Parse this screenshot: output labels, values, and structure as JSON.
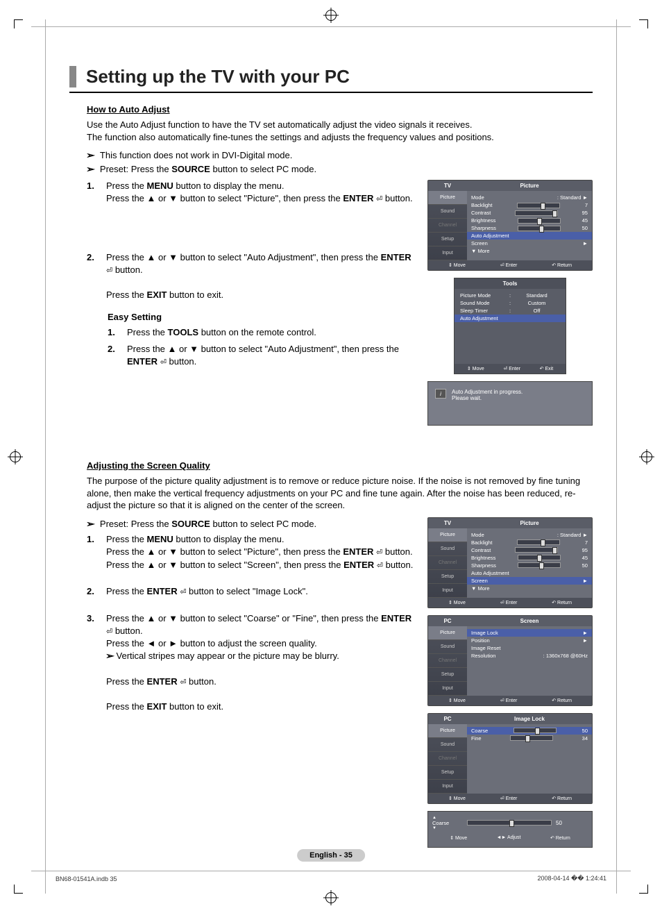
{
  "title": "Setting up the TV with your PC",
  "sec1_head": "How to Auto Adjust",
  "sec1_p1": "Use the Auto Adjust function to have the TV set automatically adjust the video signals it receives.",
  "sec1_p2": "The function also automatically fine-tunes the settings and adjusts the frequency values and positions.",
  "sec1_note1": "This function does not work in DVI-Digital mode.",
  "sec1_note2a": "Preset: Press the ",
  "sec1_note2b": "SOURCE",
  "sec1_note2c": " button to select PC mode.",
  "s1_1a": "Press the ",
  "s1_1b": "MENU",
  "s1_1c": " button to display the menu.",
  "s1_1d": "Press the ▲ or ▼ button to select \"Picture\", then press the ",
  "s1_1e": "ENTER",
  "s1_1f": " button.",
  "s1_2a": "Press the ▲ or ▼ button to select \"Auto Adjustment\", then press the ",
  "s1_2b": "ENTER",
  "s1_2c": " button.",
  "s1_2d": "Press the ",
  "s1_2e": "EXIT",
  "s1_2f": " button to exit.",
  "easy_head": "Easy Setting",
  "easy_1a": "Press the ",
  "easy_1b": "TOOLS",
  "easy_1c": " button on the remote control.",
  "easy_2a": "Press the ▲ or ▼ button to select \"Auto Adjustment\", then press the ",
  "easy_2b": "ENTER",
  "easy_2c": " button.",
  "sec2_head": "Adjusting the Screen Quality",
  "sec2_p": "The purpose of the picture quality adjustment is to remove or reduce picture noise. If the noise is not removed by fine tuning alone, then make the vertical frequency adjustments on your PC and fine tune again. After the noise has been reduced, re-adjust the picture so that it is aligned on the center of the screen.",
  "sec2_note_a": "Preset: Press the ",
  "sec2_note_b": "SOURCE",
  "sec2_note_c": " button to select PC mode.",
  "s2_1a": "Press the ",
  "s2_1b": "MENU",
  "s2_1c": " button to display the menu.",
  "s2_1d": "Press the ▲ or ▼ button to select \"Picture\", then press the ",
  "s2_1e": "ENTER",
  "s2_1f": " button.",
  "s2_1g": "Press the ▲ or ▼ button to select \"Screen\", then press the ",
  "s2_1h": "ENTER",
  "s2_1i": " button.",
  "s2_2a": "Press the ",
  "s2_2b": "ENTER",
  "s2_2c": " button to select \"Image Lock\".",
  "s2_3a": "Press the ▲ or ▼ button to select \"Coarse\" or \"Fine\", then press the ",
  "s2_3b": "ENTER",
  "s2_3c": " button.",
  "s2_3d": "Press the ◄ or ► button to adjust the screen quality.",
  "s2_3e": "Vertical stripes may appear or the picture may be blurry.",
  "s2_3f": "Press the ",
  "s2_3g": "ENTER",
  "s2_3h": " button.",
  "s2_3i": "Press the ",
  "s2_3j": "EXIT",
  "s2_3k": " button to exit.",
  "osd1": {
    "left": "TV",
    "right": "Picture",
    "side": [
      "Picture",
      "Sound",
      "Channel",
      "Setup",
      "Input"
    ],
    "rows": [
      {
        "l": "Mode",
        "v": ": Standard",
        "arrow": "►"
      },
      {
        "l": "Backlight",
        "v": "7",
        "slider": 55
      },
      {
        "l": "Contrast",
        "v": "95",
        "slider": 90
      },
      {
        "l": "Brightness",
        "v": "45",
        "slider": 45
      },
      {
        "l": "Sharpness",
        "v": "50",
        "slider": 50
      }
    ],
    "hl": "Auto Adjustment",
    "scr": {
      "l": "Screen",
      "v": "►"
    },
    "more": "▼ More",
    "foot": [
      "⇕ Move",
      "⏎ Enter",
      "↶ Return"
    ]
  },
  "tools": {
    "title": "Tools",
    "rows": [
      {
        "l": "Picture Mode",
        "v": "Standard"
      },
      {
        "l": "Sound Mode",
        "v": "Custom"
      },
      {
        "l": "Sleep Timer",
        "v": "Off"
      }
    ],
    "hl": "Auto Adjustment",
    "foot": [
      "⇕ Move",
      "⏎ Enter",
      "↶ Exit"
    ]
  },
  "notebox": {
    "l1": "Auto Adjustment in progress.",
    "l2": "Please wait."
  },
  "osd2": {
    "left": "TV",
    "right": "Picture",
    "rows": [
      {
        "l": "Mode",
        "v": ": Standard",
        "arrow": "►"
      },
      {
        "l": "Backlight",
        "v": "7",
        "slider": 55
      },
      {
        "l": "Contrast",
        "v": "95",
        "slider": 90
      },
      {
        "l": "Brightness",
        "v": "45",
        "slider": 45
      },
      {
        "l": "Sharpness",
        "v": "50",
        "slider": 50
      }
    ],
    "aa": "Auto Adjustment",
    "hl": {
      "l": "Screen",
      "v": "►"
    },
    "more": "▼ More",
    "foot": [
      "⇕ Move",
      "⏎ Enter",
      "↶ Return"
    ]
  },
  "osd3": {
    "left": "PC",
    "right": "Screen",
    "rows": [
      {
        "l": "Image Lock",
        "v": "►",
        "hl": true
      },
      {
        "l": "Position",
        "v": "►"
      },
      {
        "l": "Image Reset",
        "v": ""
      },
      {
        "l": "Resolution",
        "v": ": 1360x768 @60Hz"
      }
    ],
    "foot": [
      "⇕ Move",
      "⏎ Enter",
      "↶ Return"
    ]
  },
  "osd4": {
    "left": "PC",
    "right": "Image Lock",
    "rows": [
      {
        "l": "Coarse",
        "v": "50",
        "slider": 50,
        "hl": true
      },
      {
        "l": "Fine",
        "v": "34",
        "slider": 34
      }
    ],
    "foot": [
      "⇕ Move",
      "⏎ Enter",
      "↶ Return"
    ]
  },
  "coarse": {
    "lbl": "Coarse",
    "v": "50",
    "slider": 50,
    "foot": [
      "⇕ Move",
      "◄► Adjust",
      "↶ Return"
    ]
  },
  "page_badge": "English - 35",
  "footer_l": "BN68-01541A.indb   35",
  "footer_r": "2008-04-14   �� 1:24:41"
}
